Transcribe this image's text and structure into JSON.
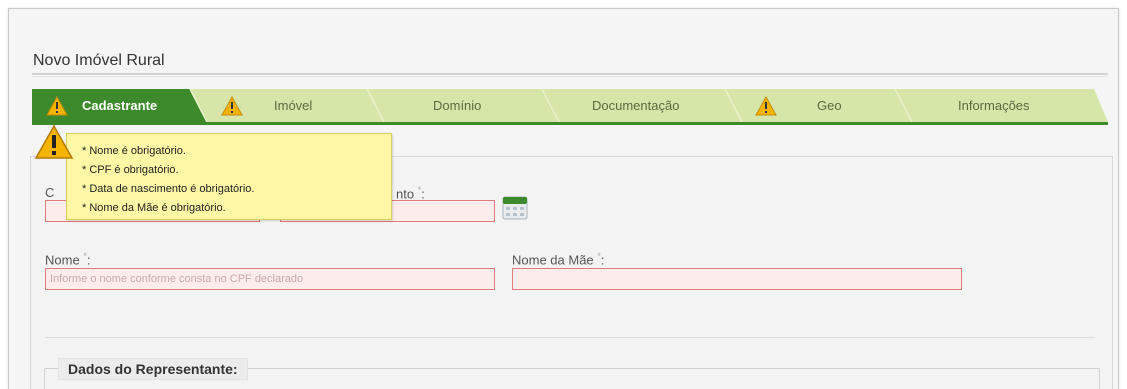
{
  "page": {
    "title": "Novo Imóvel Rural"
  },
  "wizard": {
    "tabs": [
      {
        "label": "Cadastrante",
        "active": true,
        "warning": true
      },
      {
        "label": "Imóvel",
        "active": false,
        "warning": true
      },
      {
        "label": "Domínio",
        "active": false,
        "warning": false
      },
      {
        "label": "Documentação",
        "active": false,
        "warning": false
      },
      {
        "label": "Geo",
        "active": false,
        "warning": true
      },
      {
        "label": "Informações",
        "active": false,
        "warning": false
      }
    ],
    "colors": {
      "active": "#3d8a2c",
      "inactive": "#d6e6a9",
      "separator": "#e9f2c8",
      "warning": "#f4b400"
    }
  },
  "validation_tooltip": {
    "messages": [
      "* Nome é obrigatório.",
      "* CPF é obrigatório.",
      "* Data de nascimento é obrigatório.",
      "* Nome da Mãe é obrigatório."
    ],
    "icon": "warning-icon"
  },
  "form": {
    "partial_label_left": "C",
    "partial_label_right": "nto",
    "required_mark": "*",
    "name_label": "Nome",
    "name_placeholder": "Informe o nome conforme consta no CPF declarado",
    "mother_name_label": "Nome da Mãe",
    "mother_name_value": "",
    "calendar_icon": "calendar-icon",
    "label_suffix": ":"
  },
  "representative": {
    "legend": "Dados do Representante:"
  }
}
